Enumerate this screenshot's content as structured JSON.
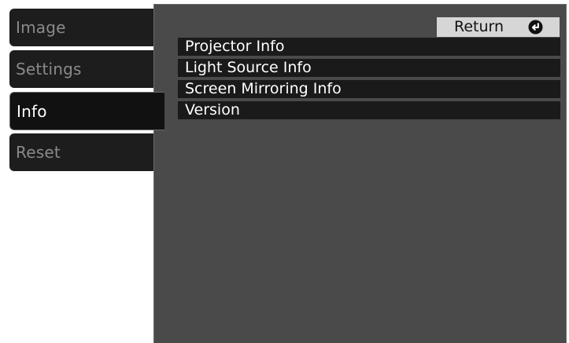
{
  "sidebar": {
    "items": [
      {
        "label": "Image",
        "active": false
      },
      {
        "label": "Settings",
        "active": false
      },
      {
        "label": "Info",
        "active": true
      },
      {
        "label": "Reset",
        "active": false
      }
    ]
  },
  "header": {
    "return_label": "Return",
    "return_icon": "enter-arrow-icon"
  },
  "menu": {
    "items": [
      {
        "label": "Projector Info"
      },
      {
        "label": "Light Source Info"
      },
      {
        "label": "Screen Mirroring Info"
      },
      {
        "label": "Version"
      }
    ]
  },
  "colors": {
    "tab_background": "#1d1d1d",
    "panel_background": "#4a4a4a",
    "menu_item_background": "#1a1a1a",
    "return_button_background": "#d6d6d6",
    "inactive_text": "#8a8a8a",
    "active_text": "#ffffff"
  }
}
